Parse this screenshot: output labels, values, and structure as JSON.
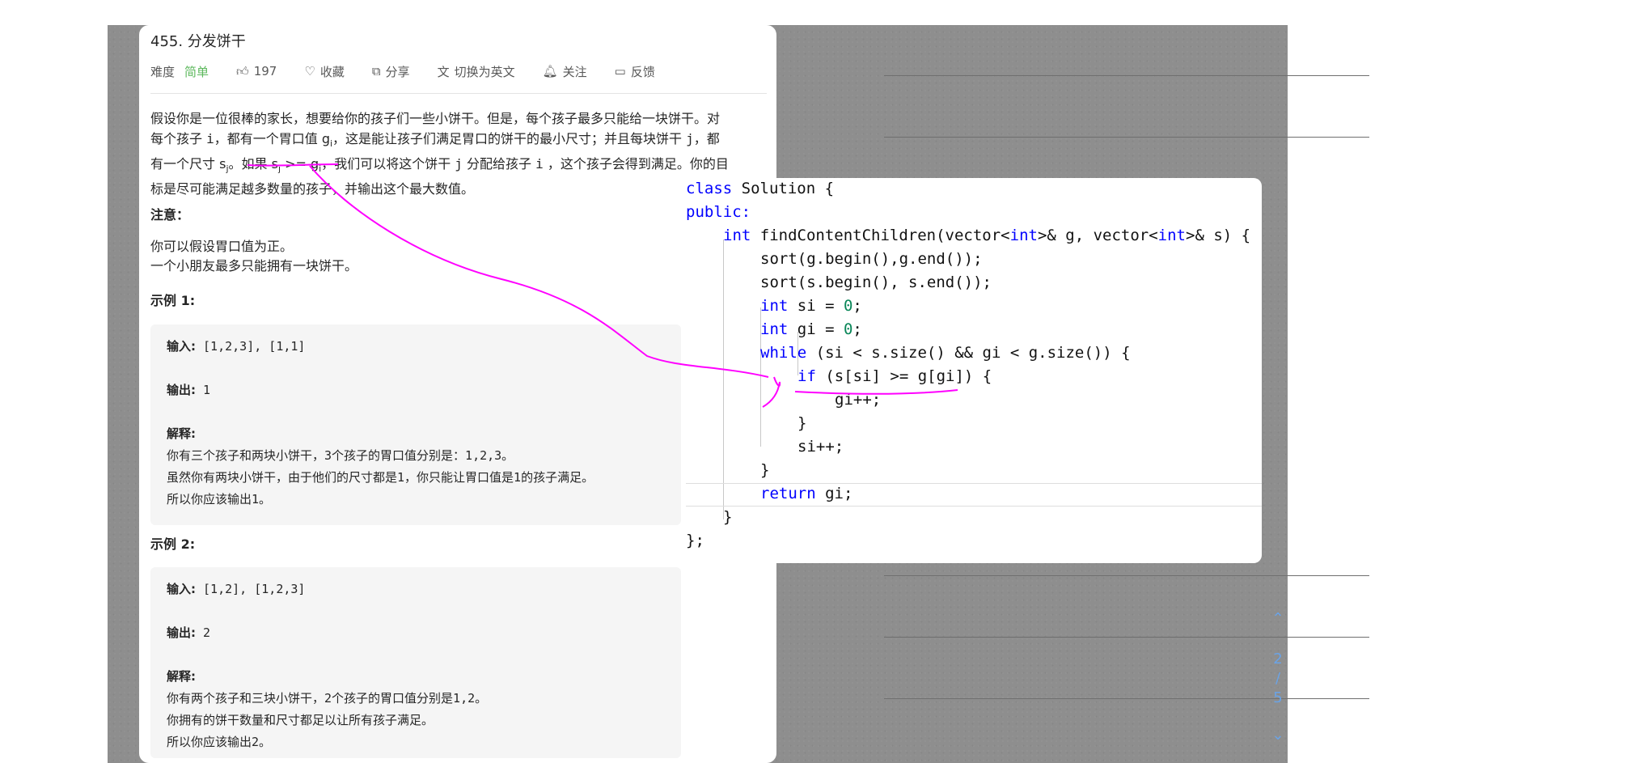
{
  "problem": {
    "title": "455. 分发饼干",
    "difficulty_label": "难度",
    "difficulty": "简单",
    "likes": "197",
    "favorite": "收藏",
    "share": "分享",
    "switch_lang": "切换为英文",
    "follow": "关注",
    "feedback": "反馈",
    "desc": {
      "l1": "假设你是一位很棒的家长，想要给你的孩子们一些小饼干。但是，每个孩子最多只能给一块饼干。对",
      "l2a": "每个孩子 ",
      "i1": "i",
      "l2b": "，都有一个胃口值 ",
      "g": "g",
      "sub_i": "i",
      "l2c": "，这是能让孩子们满足胃口的饼干的最小尺寸；并且每块饼干 ",
      "j1": "j",
      "l2d": "，都",
      "l3a": "有一个尺寸 ",
      "s": "s",
      "sub_j": "j",
      "l3b": "。如果 ",
      "cond": "s",
      "cond_sub_j": "j",
      "cond_mid": " >= g",
      "cond_sub_i": "i",
      "l3c": "，我们可以将这个饼干 ",
      "j2": "j",
      "l3d": " 分配给孩子 ",
      "i2": "i",
      "l3e": " ，这个孩子会得到满足。你的目",
      "l4": "标是尽可能满足越多数量的孩子，并输出这个最大数值。"
    },
    "note_title": "注意：",
    "note_1": "你可以假设胃口值为正。",
    "note_2": "一个小朋友最多只能拥有一块饼干。",
    "example1": {
      "title": "示例 1:",
      "input_label": "输入:",
      "input": " [1,2,3], [1,1]",
      "output_label": "输出:",
      "output": " 1",
      "explain_label": "解释:",
      "explain_1": "你有三个孩子和两块小饼干，3个孩子的胃口值分别是：1,2,3。",
      "explain_2": "虽然你有两块小饼干，由于他们的尺寸都是1，你只能让胃口值是1的孩子满足。",
      "explain_3": "所以你应该输出1。"
    },
    "example2": {
      "title": "示例 2:",
      "input_label": "输入:",
      "input": " [1,2], [1,2,3]",
      "output_label": "输出:",
      "output": " 2",
      "explain_label": "解释:",
      "explain_1": "你有两个孩子和三块小饼干，2个孩子的胃口值分别是1,2。",
      "explain_2": "你拥有的饼干数量和尺寸都足以让所有孩子满足。",
      "explain_3": "所以你应该输出2。"
    }
  },
  "code": {
    "l1_kw": "class",
    "l1_rest": " Solution {",
    "l2_kw": "public:",
    "l3_kw": "int",
    "l3_a": " findContentChildren(vector<",
    "l3_kw2": "int",
    "l3_b": ">& g, vector<",
    "l3_kw3": "int",
    "l3_c": ">& s) {",
    "l4": "sort(g.begin(),g.end());",
    "l5": "sort(s.begin(), s.end());",
    "l6_kw": "int",
    "l6_a": " si = ",
    "l6_n": "0",
    "l6_b": ";",
    "l7_kw": "int",
    "l7_a": " gi = ",
    "l7_n": "0",
    "l7_b": ";",
    "l8_kw": "while",
    "l8_a": " (si < s.size() && gi < g.size()) {",
    "l9_kw": "if",
    "l9_a": " (s[si] >= g[gi]) {",
    "l10": "gi++;",
    "l11": "}",
    "l12": "si++;",
    "l13": "}",
    "l14_kw": "return",
    "l14_a": " gi;",
    "l15": "}",
    "l16": "};"
  },
  "pager": {
    "current": "2",
    "sep": "/",
    "total": "5"
  },
  "colors": {
    "easy": "#5cb85c",
    "keyword": "#0000ff",
    "number": "#098658",
    "annotation": "#ff00ff",
    "pager": "#6aa3e6"
  }
}
